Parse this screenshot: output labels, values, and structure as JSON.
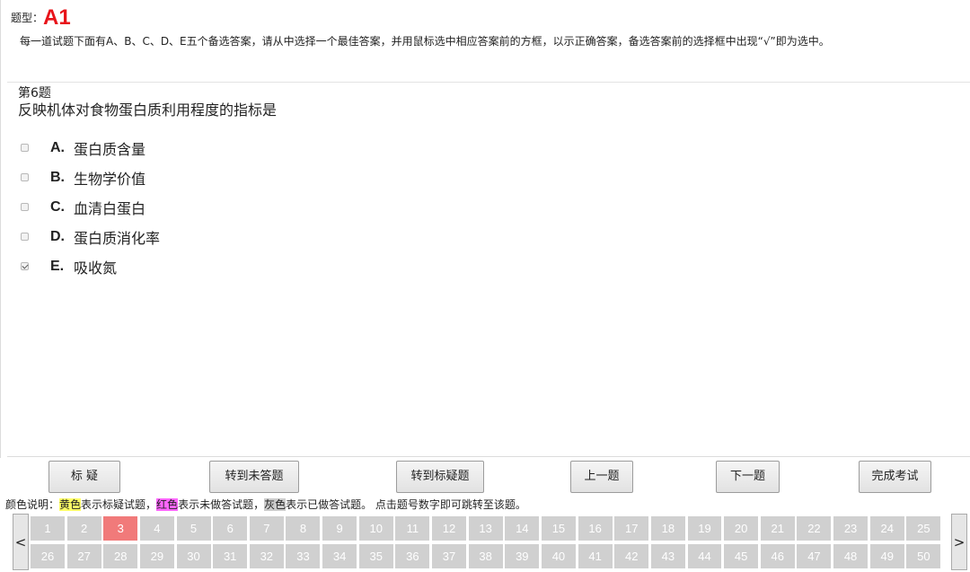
{
  "header": {
    "type_label": "题型：",
    "type_value": "A1",
    "instructions": "每一道试题下面有A、B、C、D、E五个备选答案，请从中选择一个最佳答案，并用鼠标选中相应答案前的方框，以示正确答案，备选答案前的选择框中出现“√”即为选中。"
  },
  "question": {
    "number": "第6题",
    "text": "反映机体对食物蛋白质利用程度的指标是",
    "options": [
      {
        "letter": "A.",
        "text": "蛋白质含量",
        "checked": false
      },
      {
        "letter": "B.",
        "text": "生物学价值",
        "checked": false
      },
      {
        "letter": "C.",
        "text": "血清白蛋白",
        "checked": false
      },
      {
        "letter": "D.",
        "text": "蛋白质消化率",
        "checked": false
      },
      {
        "letter": "E.",
        "text": "吸收氮",
        "checked": true
      }
    ]
  },
  "toolbar": {
    "mark": "标 疑",
    "goto_unanswered": "转到未答题",
    "goto_marked": "转到标疑题",
    "prev": "上一题",
    "next": "下一题",
    "finish": "完成考试"
  },
  "legend": {
    "prefix": "颜色说明：",
    "yellow_word": "黄色",
    "yellow_desc": "表示标疑试题，",
    "red_word": "红色",
    "red_desc": "表示未做答试题，",
    "gray_word": "灰色",
    "gray_desc": "表示已做答试题。 点击题号数字即可跳转至该题。"
  },
  "navigator": {
    "left_arrow": "<",
    "right_arrow": ">",
    "current": 3,
    "row1": [
      "1",
      "2",
      "3",
      "4",
      "5",
      "6",
      "7",
      "8",
      "9",
      "10",
      "11",
      "12",
      "13",
      "14",
      "15",
      "16",
      "17",
      "18",
      "19",
      "20",
      "21",
      "22",
      "23",
      "24",
      "25"
    ],
    "row2": [
      "26",
      "27",
      "28",
      "29",
      "30",
      "31",
      "32",
      "33",
      "34",
      "35",
      "36",
      "37",
      "38",
      "39",
      "40",
      "41",
      "42",
      "43",
      "44",
      "45",
      "46",
      "47",
      "48",
      "49",
      "50"
    ]
  },
  "colors": {
    "accent_red": "#e8141b",
    "current_cell": "#f17a7a",
    "answered_cell": "#d0d0d0",
    "legend_yellow": "#ffff66",
    "legend_red": "#ff66ff",
    "legend_gray": "#cccccc"
  }
}
